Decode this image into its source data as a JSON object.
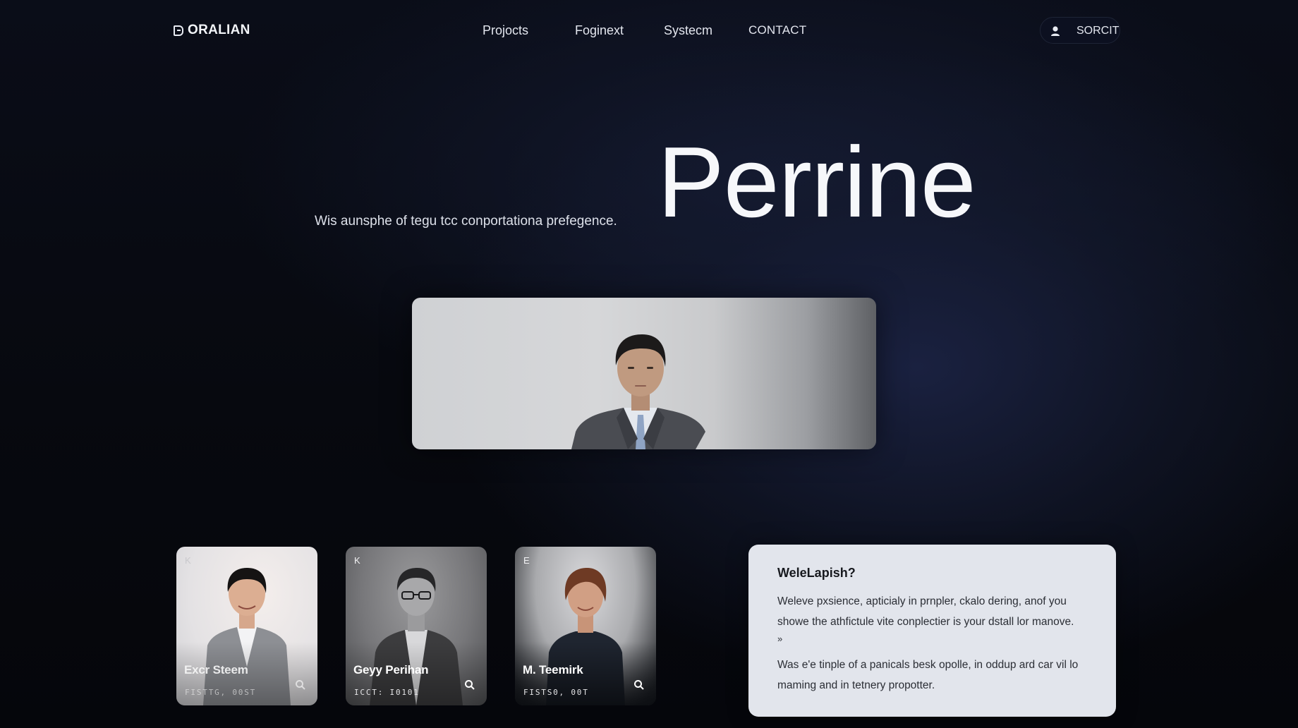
{
  "brand": {
    "name": "ORALIAN"
  },
  "nav": {
    "items": [
      {
        "label": "Projocts"
      },
      {
        "label": "Foginext"
      },
      {
        "label": "Systecm"
      },
      {
        "label": "CONTACT"
      }
    ]
  },
  "header": {
    "search_label": "SORCIT"
  },
  "hero": {
    "title": "Perrine",
    "subtitle": "Wis aunsphe of tegu tcc conportationa prefegence."
  },
  "team": {
    "cards": [
      {
        "letter": "K",
        "name": "Excr Steem",
        "meta": "FISTTG, 00ST"
      },
      {
        "letter": "K",
        "name": "Geyy Perihan",
        "meta": "ICCT: I0101"
      },
      {
        "letter": "E",
        "name": "M. Teemirk",
        "meta": "FISTS0, 00T"
      }
    ]
  },
  "info": {
    "title": "WeleLapish?",
    "paragraph1": "Weleve pxsience, apticialy in prnpler, ckalo dering, anof you showe the athfictule vite conplectier is your dstall lor manove.",
    "arrow": "»",
    "paragraph2": "Was e'e tinple of a panicals besk opolle, in oddup ard car vil lo maming and in tetnery propotter."
  },
  "colors": {
    "background": "#07090f",
    "panel": "#e2e5ec",
    "text_light": "#e8ebf2",
    "text_dark": "#23262d"
  }
}
